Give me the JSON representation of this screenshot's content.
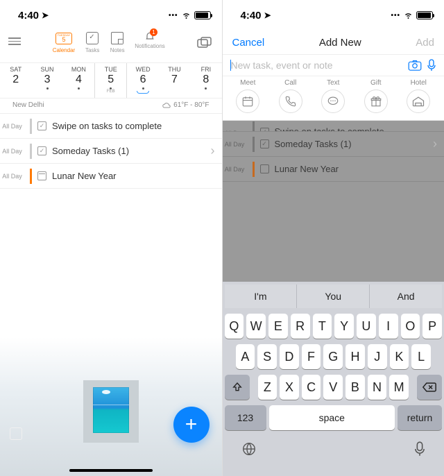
{
  "status": {
    "time": "4:40",
    "battery_pct": 85
  },
  "toolbar": {
    "calendar": {
      "label": "Calendar",
      "day": "5",
      "weekday": "TUESDAY"
    },
    "tasks": "Tasks",
    "notes": "Notes",
    "notifications": "Notifications",
    "badge": "1"
  },
  "week": [
    {
      "name": "SAT",
      "num": "2",
      "dot": false
    },
    {
      "name": "SUN",
      "num": "3",
      "dot": true
    },
    {
      "name": "MON",
      "num": "4",
      "dot": true
    },
    {
      "name": "TUE",
      "num": "5",
      "dot": true,
      "month": "FEB",
      "selected": true
    },
    {
      "name": "WED",
      "num": "6",
      "dot": true,
      "underline": true
    },
    {
      "name": "THU",
      "num": "7",
      "dot": false
    },
    {
      "name": "FRI",
      "num": "8",
      "dot": true
    }
  ],
  "subbar": {
    "location": "New Delhi",
    "weather": "61°F - 80°F"
  },
  "tasks": [
    {
      "allday": "All Day",
      "type": "check",
      "title": "Swipe on tasks to complete",
      "bar": "grey",
      "chevron": false
    },
    {
      "allday": "All Day",
      "type": "check",
      "title": "Someday Tasks (1)",
      "bar": "grey",
      "chevron": true
    },
    {
      "allday": "All Day",
      "type": "calendar",
      "title": "Lunar New Year",
      "bar": "orange",
      "chevron": false
    }
  ],
  "modal": {
    "cancel": "Cancel",
    "title": "Add New",
    "add": "Add",
    "placeholder": "New task, event or note",
    "quick": [
      {
        "label": "Meet",
        "icon": "calendar"
      },
      {
        "label": "Call",
        "icon": "phone"
      },
      {
        "label": "Text",
        "icon": "chat"
      },
      {
        "label": "Gift",
        "icon": "gift"
      },
      {
        "label": "Hotel",
        "icon": "hotel"
      }
    ]
  },
  "dimmed_tasks": [
    {
      "allday": "All Day",
      "type": "check",
      "title": "Swipe on tasks to complete",
      "bar": "grey",
      "partial": true
    },
    {
      "allday": "All Day",
      "type": "check",
      "title": "Someday Tasks (1)",
      "bar": "grey",
      "chevron": true
    },
    {
      "allday": "All Day",
      "type": "calendar",
      "title": "Lunar New Year",
      "bar": "orange"
    }
  ],
  "keyboard": {
    "suggestions": [
      "I'm",
      "You",
      "And"
    ],
    "row1": [
      "Q",
      "W",
      "E",
      "R",
      "T",
      "Y",
      "U",
      "I",
      "O",
      "P"
    ],
    "row2": [
      "A",
      "S",
      "D",
      "F",
      "G",
      "H",
      "J",
      "K",
      "L"
    ],
    "row3": [
      "Z",
      "X",
      "C",
      "V",
      "B",
      "N",
      "M"
    ],
    "numeric": "123",
    "space": "space",
    "return": "return"
  }
}
